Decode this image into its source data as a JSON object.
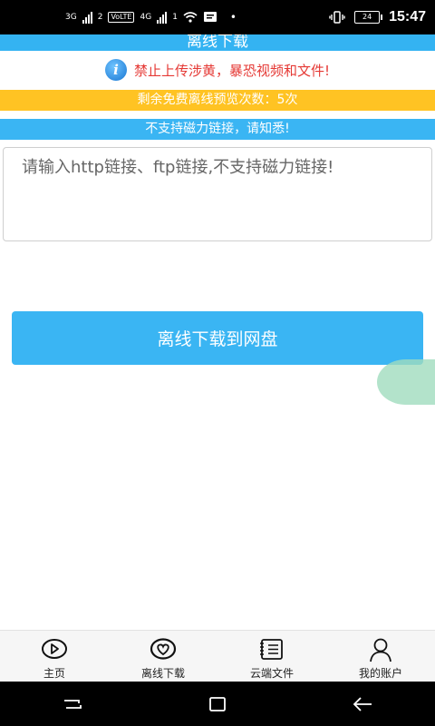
{
  "status_bar": {
    "network1": "3G",
    "network2": "4G",
    "sim1": "2",
    "sim2": "1",
    "volte": "VoLTE",
    "battery": "24",
    "time": "15:47"
  },
  "header": {
    "title": "离线下载"
  },
  "warning": {
    "text": "禁止上传涉黄，暴恐视频和文件!"
  },
  "quota": {
    "text": "剩余免费离线预览次数：5次"
  },
  "notice": {
    "text": "不支持磁力链接，请知悉!"
  },
  "url_input": {
    "placeholder": "请输入http链接、ftp链接,不支持磁力链接!"
  },
  "action": {
    "label": "离线下载到网盘"
  },
  "tabs": [
    {
      "label": "主页",
      "icon": "play-icon"
    },
    {
      "label": "离线下载",
      "icon": "heart-icon"
    },
    {
      "label": "云端文件",
      "icon": "file-list-icon"
    },
    {
      "label": "我的账户",
      "icon": "user-icon"
    }
  ],
  "colors": {
    "accent_blue": "#3ab5f3",
    "quota_yellow": "#ffc323",
    "warning_red": "#e53935"
  }
}
